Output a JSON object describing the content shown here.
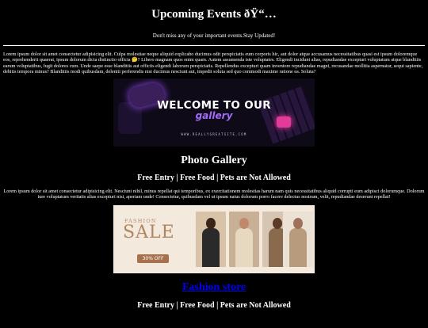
{
  "header": {
    "title": "Upcoming Events ðŸ“…",
    "tagline": "Don't miss any of your important events.Stay Updated!"
  },
  "intro": {
    "text": "Lorem ipsum dolor sit amet consectetur adipisicing elit. Culpa molestiae neque aliquid explicabo ducimus odit perspiciatis eum corporis hic, aut dolor atque accusamus necessitatibus quasi est ipsum doloremque eos, reprehenderit quaerat, ipsum dolorum dicta distinctio officia 🤔? Libero magnam quos enim quam. Autem assumenda iste voluptates. Eligendi incidunt alias, repudiandae excepturi voluptatum atque blanditiis earum voluptatibus, fugit dolores cum. Unde saepe esse blanditiis aut officiis eligendi laborum perspiciatis. Repellendus excepturi quam inventore repudiandae magni, recusandae mollitia aspernatur, sequi sapiente, debitis tempora minus? Blanditiis modi quibusdam, deleniti perferendis nisi ducimus nesciunt aut, impedit soluta sed quo commodi maxime ratione ea. Soluta?"
  },
  "banner_welcome": {
    "title": "WELCOME TO OUR",
    "subtitle": "gallery",
    "url": "WWW.REALLYGREATSITE.COM"
  },
  "gallery": {
    "heading": "Photo Gallery",
    "features": "Free Entry | Free Food | Pets are Not Allowed",
    "text": "Lorem ipsum dolor sit amet consectetur adipisicing elit. Nesciunt nihil, minus repellat qui temporibus, ex exercitationem molestias harum nam quis necessitatibus aliquid corrupti eum adipisci dolorumque. Dolorum iure voluptatum veritatis alias excepturi nisi, aperiam unde! Consectetur, quibusdam vel ut ipsum natus dolorum porro facere delectus nostrum, velit, repudiandae deserunt repellat!"
  },
  "banner_fashion": {
    "small": "FASHION",
    "big": "SALE",
    "badge": "30% OFF"
  },
  "store": {
    "link_label": "Fashion store",
    "features": "Free Entry | Free Food | Pets are Not Allowed"
  }
}
